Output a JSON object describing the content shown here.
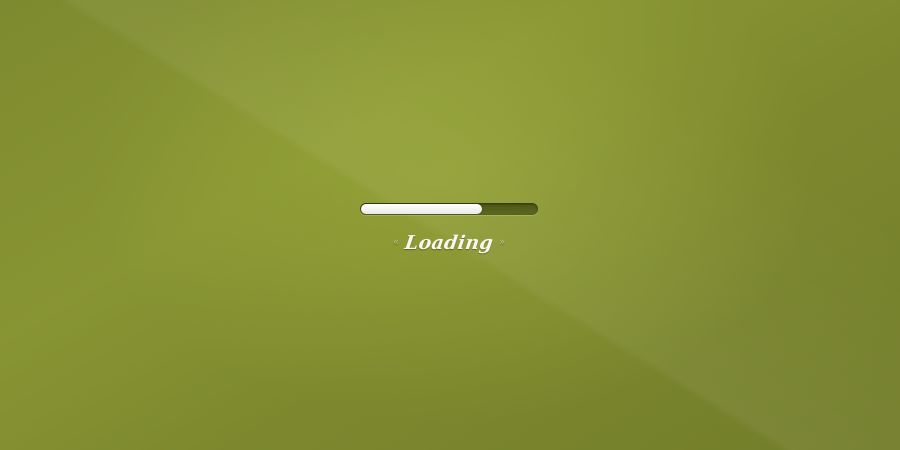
{
  "loader": {
    "progress": 0.69,
    "label": "Loading",
    "left_mark": "«",
    "right_mark": "»"
  },
  "colors": {
    "background": "#859131",
    "track": "#555f1c",
    "fill": "#ffffff",
    "text": "#f7f7ef"
  }
}
